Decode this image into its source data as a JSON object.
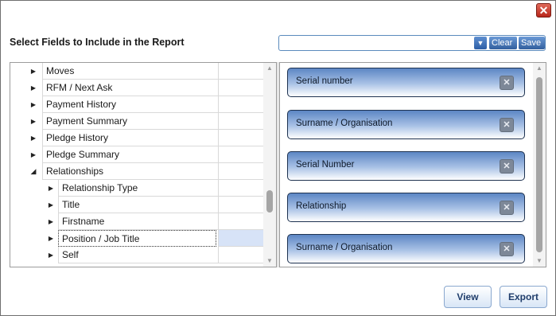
{
  "dialog": {
    "close_glyph": "✕",
    "title": "Select Fields to Include in the Report"
  },
  "layout_selector": {
    "value": "",
    "dropdown_glyph": "▼",
    "clear_label": "Clear",
    "save_label": "Save"
  },
  "tree": {
    "rows": [
      {
        "label": "Moves",
        "expander": "▶"
      },
      {
        "label": "RFM / Next Ask",
        "expander": "▶"
      },
      {
        "label": "Payment History",
        "expander": "▶"
      },
      {
        "label": "Payment Summary",
        "expander": "▶"
      },
      {
        "label": "Pledge History",
        "expander": "▶"
      },
      {
        "label": "Pledge Summary",
        "expander": "▶"
      },
      {
        "label": "Relationships",
        "expander": "◢"
      },
      {
        "label": "Relationship Type",
        "expander": "▶"
      },
      {
        "label": "Title",
        "expander": "▶"
      },
      {
        "label": "Firstname",
        "expander": "▶"
      },
      {
        "label": "Position / Job Title",
        "expander": "▶"
      },
      {
        "label": "Self",
        "expander": "▶"
      }
    ],
    "scroll_up_glyph": "▲",
    "scroll_down_glyph": "▼"
  },
  "selected_fields": {
    "items": [
      {
        "label": "Serial number",
        "remove_glyph": "✕"
      },
      {
        "label": "Surname / Organisation",
        "remove_glyph": "✕"
      },
      {
        "label": "Serial Number",
        "remove_glyph": "✕"
      },
      {
        "label": "Relationship",
        "remove_glyph": "✕"
      },
      {
        "label": "Surname / Organisation",
        "remove_glyph": "✕"
      }
    ],
    "scroll_up_glyph": "▲",
    "scroll_down_glyph": "▼"
  },
  "footer": {
    "view_label": "View",
    "export_label": "Export"
  }
}
